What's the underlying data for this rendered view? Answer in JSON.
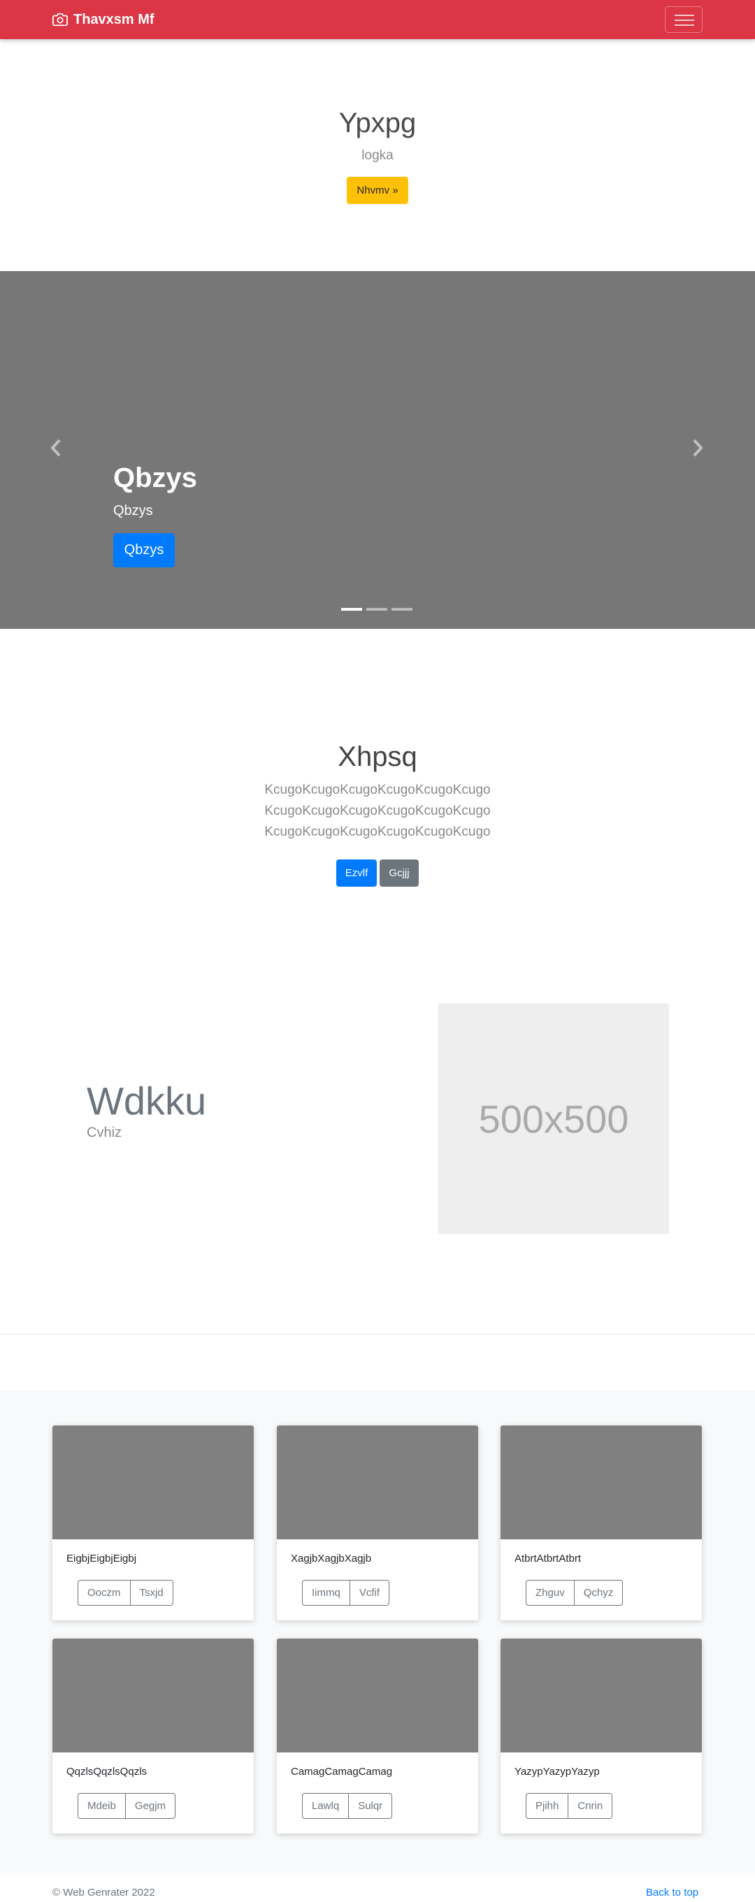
{
  "navbar": {
    "brand": "Thavxsm Mf",
    "brand_icon": "camera-icon",
    "toggler_icon": "hamburger-icon",
    "color": "#dc3545"
  },
  "hero": {
    "title": "Ypxpg",
    "subtitle": "logka",
    "button": "Nhvmv »"
  },
  "carousel": {
    "title": "Qbzys",
    "text": "Qbzys",
    "button": "Qbzys",
    "prev_icon": "chevron-left-icon",
    "next_icon": "chevron-right-icon",
    "slide_count": 3,
    "active_slide": 1
  },
  "intro": {
    "title": "Xhpsq",
    "lines": [
      "KcugoKcugoKcugoKcugoKcugoKcugo",
      "KcugoKcugoKcugoKcugoKcugoKcugo",
      "KcugoKcugoKcugoKcugoKcugoKcugo"
    ],
    "primary_button": "Ezvlf",
    "secondary_button": "Gcjjj"
  },
  "feature": {
    "title": "Wdkku",
    "subtitle": "Cvhiz",
    "image_placeholder": "500x500"
  },
  "album": {
    "cards": [
      {
        "text": "EigbjEigbjEigbj",
        "buttons": [
          "Ooczm",
          "Tsxjd"
        ]
      },
      {
        "text": "XagjbXagjbXagjb",
        "buttons": [
          "Iimmq",
          "Vcfif"
        ]
      },
      {
        "text": "AtbrtAtbrtAtbrt",
        "buttons": [
          "Zhguv",
          "Qchyz"
        ]
      },
      {
        "text": "QqzlsQqzlsQqzls",
        "buttons": [
          "Mdeib",
          "Gegjm"
        ]
      },
      {
        "text": "CamagCamagCamag",
        "buttons": [
          "Lawlq",
          "Sulqr"
        ]
      },
      {
        "text": "YazypYazypYazyp",
        "buttons": [
          "Pjihh",
          "Cnrin"
        ]
      }
    ]
  },
  "footer": {
    "copyright": "© Web Genrater 2022",
    "back_to_top": "Back to top"
  }
}
